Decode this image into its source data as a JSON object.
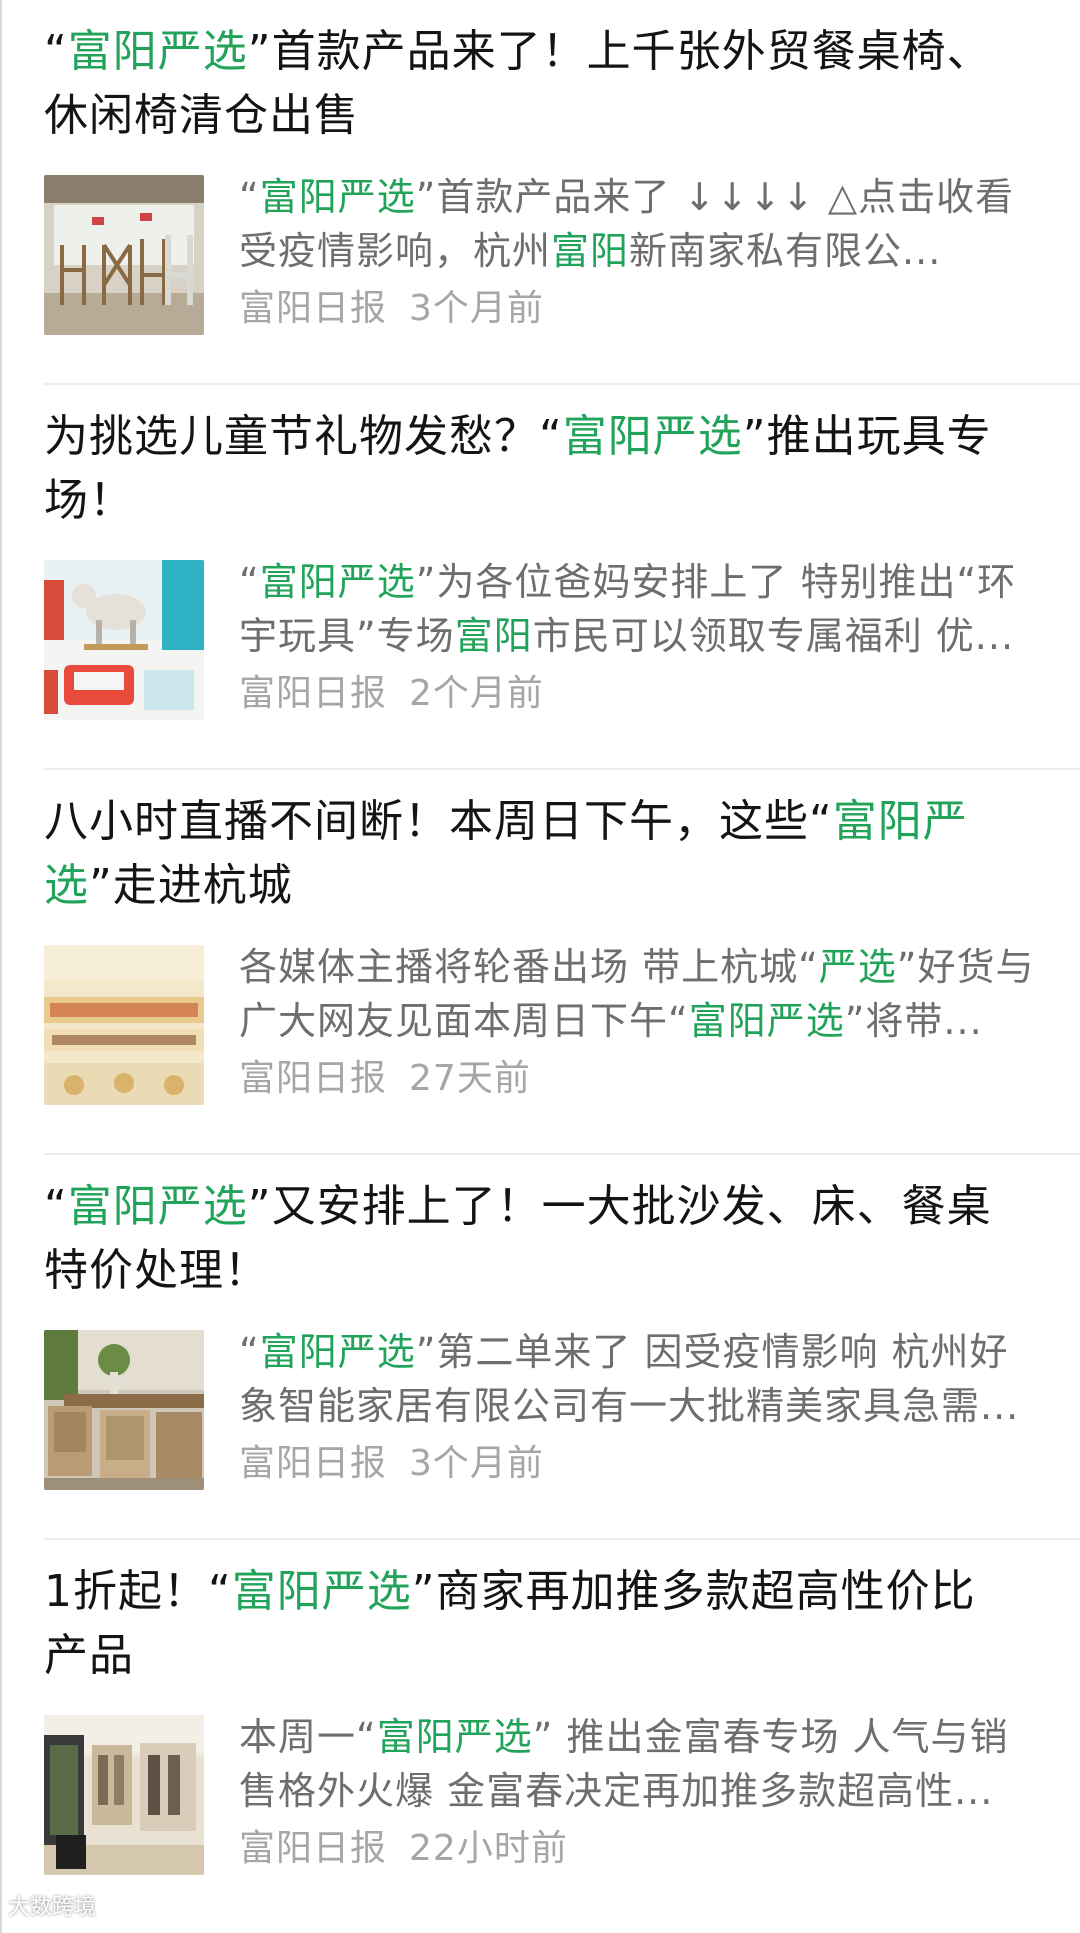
{
  "articles": [
    {
      "title": [
        "“",
        {
          "hl": "富阳严选"
        },
        "”首款产品来了！上千张外贸餐桌椅、休闲椅清仓出售"
      ],
      "summary": [
        "“",
        {
          "hl": "富阳严选"
        },
        "”首款产品来了 ↓↓↓↓ △点击收看 受疫情影响，杭州",
        {
          "hl": "富阳"
        },
        "新南家私有限公..."
      ],
      "source": "富阳日报",
      "time": "3个月前",
      "thumb_icon": "furniture-chairs-photo"
    },
    {
      "title": [
        "为挑选儿童节礼物发愁？“",
        {
          "hl": "富阳严选"
        },
        "”推出玩具专场！"
      ],
      "summary": [
        "“",
        {
          "hl": "富阳严选"
        },
        "”为各位爸妈安排上了 特别推出“环宇玩具”专场",
        {
          "hl": "富阳"
        },
        "市民可以领取专属福利 优..."
      ],
      "source": "富阳日报",
      "time": "2个月前",
      "thumb_icon": "toy-horse-photo"
    },
    {
      "title": [
        "八小时直播不间断！本周日下午，这些“",
        {
          "hl": "富阳严选"
        },
        "”走进杭城"
      ],
      "summary": [
        "各媒体主播将轮番出场 带上杭城“",
        {
          "hl": "严选"
        },
        "”好货与广大网友见面本周日下午“",
        {
          "hl": "富阳严选"
        },
        "”将带..."
      ],
      "source": "富阳日报",
      "time": "27天前",
      "thumb_icon": "promo-banner-photo"
    },
    {
      "title": [
        "“",
        {
          "hl": "富阳严选"
        },
        "”又安排上了！一大批沙发、床、餐桌特价处理！"
      ],
      "summary": [
        "“",
        {
          "hl": "富阳严选"
        },
        "”第二单来了 因受疫情影响 杭州好象智能家居有限公司有一大批精美家具急需..."
      ],
      "source": "富阳日报",
      "time": "3个月前",
      "thumb_icon": "dining-table-photo"
    },
    {
      "title": [
        "1折起！“",
        {
          "hl": "富阳严选"
        },
        "”商家再加推多款超高性价比产品"
      ],
      "summary": [
        "本周一“",
        {
          "hl": "富阳严选"
        },
        "” 推出金富春专场 人气与销售格外火爆 金富春决定再加推多款超高性..."
      ],
      "source": "富阳日报",
      "time": "22小时前",
      "thumb_icon": "store-interior-photo"
    }
  ],
  "colors": {
    "highlight": "#21a35a",
    "meta": "#a6a6a6",
    "summary": "#6e6e6e"
  },
  "watermark": "大数跨境"
}
